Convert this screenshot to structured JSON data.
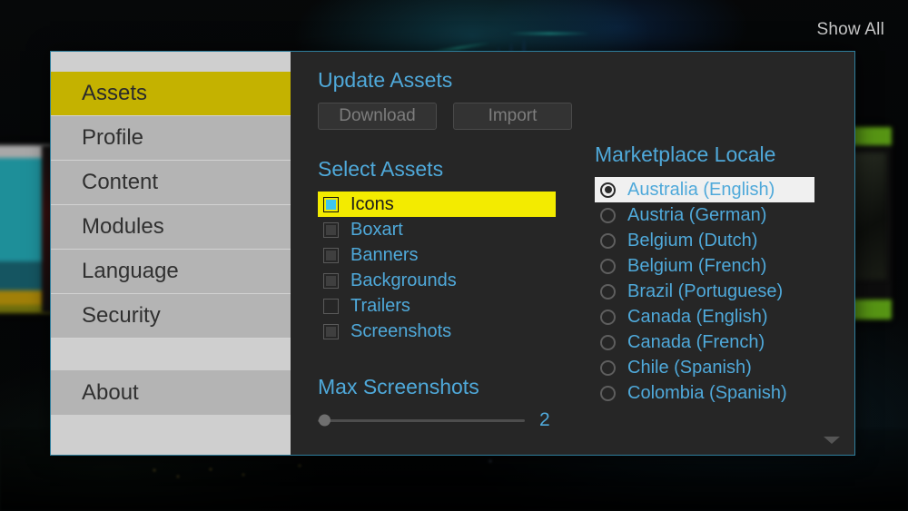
{
  "overlay": {
    "show_all_label": "Show All"
  },
  "sidebar": {
    "items": [
      {
        "label": "Assets",
        "active": true
      },
      {
        "label": "Profile",
        "active": false
      },
      {
        "label": "Content",
        "active": false
      },
      {
        "label": "Modules",
        "active": false
      },
      {
        "label": "Language",
        "active": false
      },
      {
        "label": "Security",
        "active": false
      }
    ],
    "footer_item": {
      "label": "About"
    }
  },
  "update_assets": {
    "title": "Update Assets",
    "download_label": "Download",
    "import_label": "Import"
  },
  "select_assets": {
    "title": "Select Assets",
    "items": [
      {
        "label": "Icons",
        "checked": true,
        "highlight": true
      },
      {
        "label": "Boxart",
        "checked": true,
        "highlight": false
      },
      {
        "label": "Banners",
        "checked": true,
        "highlight": false
      },
      {
        "label": "Backgrounds",
        "checked": true,
        "highlight": false
      },
      {
        "label": "Trailers",
        "checked": false,
        "highlight": false
      },
      {
        "label": "Screenshots",
        "checked": true,
        "highlight": false
      }
    ]
  },
  "max_screenshots": {
    "title": "Max Screenshots",
    "value": "2",
    "fill_percent": 2
  },
  "marketplace_locale": {
    "title": "Marketplace Locale",
    "items": [
      {
        "label": "Australia (English)",
        "selected": true
      },
      {
        "label": "Austria (German)",
        "selected": false
      },
      {
        "label": "Belgium (Dutch)",
        "selected": false
      },
      {
        "label": "Belgium (French)",
        "selected": false
      },
      {
        "label": "Brazil (Portuguese)",
        "selected": false
      },
      {
        "label": "Canada (English)",
        "selected": false
      },
      {
        "label": "Canada (French)",
        "selected": false
      },
      {
        "label": "Chile (Spanish)",
        "selected": false
      },
      {
        "label": "Colombia (Spanish)",
        "selected": false
      }
    ],
    "scroll_indicator": "chevron-down-icon"
  },
  "colors": {
    "accent_blue": "#4fa9da",
    "highlight_yellow": "#f3eb00",
    "nav_active": "#c4b200",
    "dialog_border": "#2e7e9c",
    "panel_bg": "#262626",
    "sidebar_bg": "#b4b4b4"
  }
}
